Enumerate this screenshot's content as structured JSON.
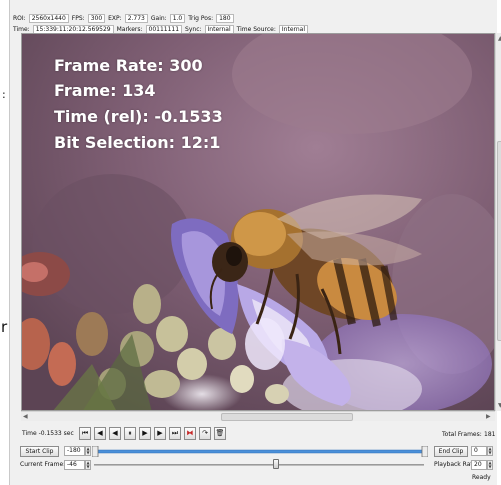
{
  "header": {
    "roi_label": "ROI:",
    "roi": "2560x1440",
    "fps_label": "FPS:",
    "fps": "300",
    "exp_label": "EXP:",
    "exp": "2.773",
    "gain_label": "Gain:",
    "gain": "1.0",
    "trig_label": "Trig Pos:",
    "trig": "180",
    "time_label": "Time:",
    "time": "15:339:11:20:12.569529",
    "markers_label": "Markers:",
    "markers": "00111111",
    "sync_label": "Sync:",
    "sync": "Internal",
    "timesrc_label": "Time Source:",
    "timesrc": "Internal"
  },
  "overlay": {
    "frame_rate": "Frame Rate: 300",
    "frame": "Frame: 134",
    "time_rel": "Time (rel): -0.1533",
    "bit_selection": "Bit Selection: 12:1"
  },
  "transport": {
    "time_label": "Time -0.1533 sec",
    "total_frames_label": "Total Frames:",
    "total_frames": "181",
    "start_clip": "Start Clip",
    "start_value": "-180",
    "end_clip": "End Clip",
    "end_value": "0",
    "current_frame_label": "Current Frame:",
    "current_frame": "-46",
    "playback_rate_label": "Playback Rate:",
    "playback_rate": "20",
    "clip_range": {
      "min": -180,
      "max": 0,
      "start": -180,
      "end": 0
    },
    "frame_position_fraction": 0.55
  },
  "buttons": {
    "first": "⏮",
    "step_back": "◀",
    "play_back": "◀",
    "pause": "⏸",
    "play": "▶",
    "step_fwd": "▶",
    "last": "⏭",
    "trim": "⧓",
    "goto": "↷",
    "delete": "🗑"
  },
  "status": "Ready",
  "edge_text": {
    "colon": ":",
    "r": "r"
  },
  "colors": {
    "window": "#f0f0f0",
    "slider_blue": "#4a8fd8",
    "overlay_text": "#ffffff"
  }
}
